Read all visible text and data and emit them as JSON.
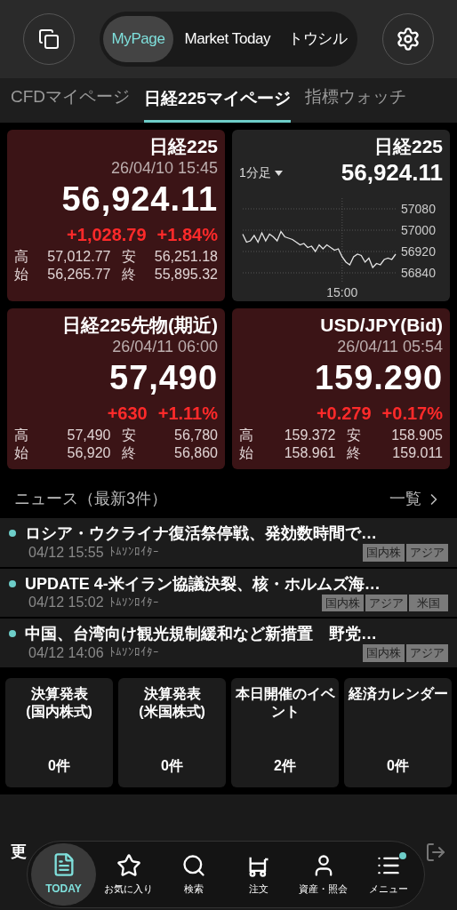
{
  "header": {
    "segments": [
      {
        "label": "MyPage",
        "selected": true
      },
      {
        "label": "Market Today",
        "selected": false
      },
      {
        "label": "トウシル",
        "selected": false
      }
    ]
  },
  "tabs": [
    {
      "label": "CFDマイページ",
      "selected": false
    },
    {
      "label": "日経225マイページ",
      "selected": true
    },
    {
      "label": "指標ウォッチ",
      "selected": false
    }
  ],
  "cards": [
    {
      "kind": "quote",
      "title": "日経225",
      "time": "26/04/10 15:45",
      "price": "56,924.11",
      "change": "+1,028.79",
      "change_pct": "+1.84%",
      "stats": [
        {
          "label": "高",
          "value": "57,012.77"
        },
        {
          "label": "安",
          "value": "56,251.18"
        },
        {
          "label": "始",
          "value": "56,265.77"
        },
        {
          "label": "終",
          "value": "55,895.32"
        }
      ]
    },
    {
      "kind": "chart",
      "title": "日経225",
      "interval": "1分足",
      "price": "56,924.11",
      "chart_data": {
        "type": "line",
        "ylim": [
          56800,
          57120
        ],
        "yticks": [
          57080,
          57000,
          56920,
          56840
        ],
        "grid": true,
        "annotations": [
          "15:00"
        ],
        "series": [
          {
            "color": "#e5e5e5",
            "values": [
              56985,
              56955,
              56960,
              56980,
              56955,
              56990,
              56960,
              56985,
              56975,
              56960,
              56995,
              56975,
              56970,
              56965,
              56955,
              56945,
              56950,
              56935,
              56940,
              56920,
              56945,
              56930,
              56945,
              56935,
              56925,
              56930,
              56900,
              56880,
              56870,
              56900,
              56910,
              56905,
              56880,
              56895,
              56860,
              56875,
              56870,
              56890,
              56895,
              56890,
              56910
            ]
          }
        ]
      }
    },
    {
      "kind": "quote",
      "title": "日経225先物(期近)",
      "time": "26/04/11 06:00",
      "price": "57,490",
      "change": "+630",
      "change_pct": "+1.11%",
      "stats": [
        {
          "label": "高",
          "value": "57,490"
        },
        {
          "label": "安",
          "value": "56,780"
        },
        {
          "label": "始",
          "value": "56,920"
        },
        {
          "label": "終",
          "value": "56,860"
        }
      ]
    },
    {
      "kind": "quote",
      "title": "USD/JPY(Bid)",
      "time": "26/04/11 05:54",
      "price": "159.290",
      "change": "+0.279",
      "change_pct": "+0.17%",
      "stats": [
        {
          "label": "高",
          "value": "159.372"
        },
        {
          "label": "安",
          "value": "158.905"
        },
        {
          "label": "始",
          "value": "158.961"
        },
        {
          "label": "終",
          "value": "159.011"
        }
      ]
    }
  ],
  "news": {
    "title": "ニュース（最新3件）",
    "more": "一覧",
    "items": [
      {
        "headline": "ロシア・ウクライナ復活祭停戦、発効数時間で…",
        "time": "04/12 15:55",
        "source": "ﾄﾑｿﾝﾛｲﾀｰ",
        "tags": [
          "国内株",
          "アジア"
        ]
      },
      {
        "headline": "UPDATE 4-米イラン協議決裂、核・ホルムズ海…",
        "time": "04/12 15:02",
        "source": "ﾄﾑｿﾝﾛｲﾀｰ",
        "tags": [
          "国内株",
          "アジア",
          "米国"
        ]
      },
      {
        "headline": "中国、台湾向け観光規制緩和など新措置　野党…",
        "time": "04/12 14:06",
        "source": "ﾄﾑｿﾝﾛｲﾀｰ",
        "tags": [
          "国内株",
          "アジア"
        ]
      }
    ]
  },
  "tiles": [
    {
      "title": "決算発表\n(国内株式)",
      "count": "0件"
    },
    {
      "title": "決算発表\n(米国株式)",
      "count": "0件"
    },
    {
      "title": "本日開催のイベント",
      "count": "2件"
    },
    {
      "title": "経済カレンダー",
      "count": "0件"
    }
  ],
  "bottom_strip": {
    "label": "更"
  },
  "nav": [
    {
      "label": "TODAY",
      "selected": true,
      "badge": false
    },
    {
      "label": "お気に入り",
      "selected": false,
      "badge": false
    },
    {
      "label": "検索",
      "selected": false,
      "badge": false
    },
    {
      "label": "注文",
      "selected": false,
      "badge": false
    },
    {
      "label": "資産・照会",
      "selected": false,
      "badge": false
    },
    {
      "label": "メニュー",
      "selected": false,
      "badge": true
    }
  ]
}
